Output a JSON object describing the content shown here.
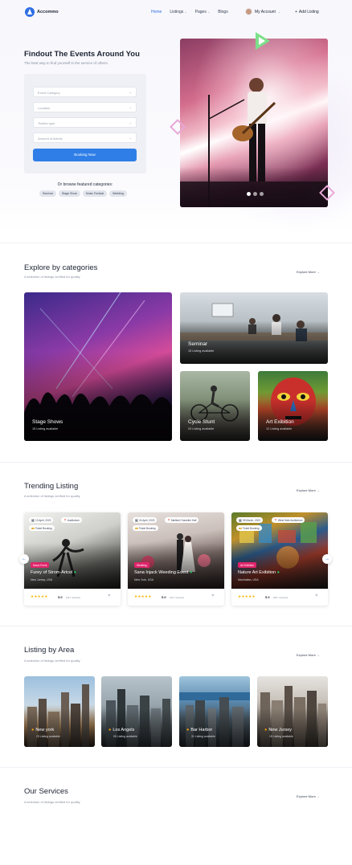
{
  "nav": {
    "logo_text": "Accommo",
    "menu": [
      {
        "label": "Home",
        "active": true
      },
      {
        "label": "Listings",
        "caret": "⌄"
      },
      {
        "label": "Pages",
        "caret": "⌄"
      },
      {
        "label": "Blogs"
      }
    ],
    "account_label": "My Account",
    "account_caret": "⌄",
    "add_listing": "Add Listing",
    "add_icon": "+"
  },
  "hero": {
    "title": "Findout The Events Around You",
    "subtitle": "The best way to find yourself in the service of others.",
    "fields": [
      {
        "placeholder": "Event Category"
      },
      {
        "placeholder": "Location"
      },
      {
        "placeholder": "Tickets type"
      },
      {
        "placeholder": "Amount of tickets"
      }
    ],
    "dropdown_icon": "⌄",
    "book_button": "Booking Now",
    "browse_label": "Or browse featured categories:",
    "tags": [
      "Seminar",
      "Stage Show",
      "Music Festival",
      "Wedding"
    ]
  },
  "categories": {
    "title": "Explore by categories",
    "subtitle": "A selection of listings verified for quality",
    "explore_more": "Explore More →",
    "items": [
      {
        "name": "Stage Shows",
        "count": "15 Listing available"
      },
      {
        "name": "Seminar",
        "count": "15 Listing available"
      },
      {
        "name": "Cycle Stunt",
        "count": "03 Listing available"
      },
      {
        "name": "Art Exibition",
        "count": "12 Listing available"
      }
    ]
  },
  "trending": {
    "title": "Trending Listing",
    "subtitle": "A selection of listings verified for quality",
    "explore_more": "Explore More →",
    "prev_icon": "←",
    "next_icon": "→",
    "cards": [
      {
        "date": "13 April, 2023",
        "venue": "Auditorium",
        "ticket": "Ticket Booking",
        "badge": "Music Event",
        "name": "Furey of Strom-Artcel",
        "location": "New Jursey, USA",
        "stars": "★★★★★",
        "rating": "5.0",
        "reviews": "(187 reviews)",
        "heart": "♥"
      },
      {
        "date": "24 April, 2023",
        "venue": "Mallbuil Chavelier Hall",
        "ticket": "Ticket Booking",
        "badge": "Wedding",
        "name": "Sana Injack Weeding Event",
        "location": "New York, USA",
        "stars": "★★★★★",
        "rating": "5.0",
        "reviews": "(107 reviews)",
        "heart": "♥"
      },
      {
        "date": "08 March, 2022",
        "venue": "West Hale Auditorium",
        "ticket": "Ticket Booking",
        "badge": "Art Exibition",
        "name": "Nature Art Exibition",
        "location": "Manhattan, USA",
        "stars": "★★★★★",
        "rating": "5.0",
        "reviews": "(837 reviews)",
        "heart": "♥"
      }
    ]
  },
  "areas": {
    "title": "Listing by Area",
    "subtitle": "A selection of listings verified for quality",
    "explore_more": "Explore More →",
    "items": [
      {
        "name": "New york",
        "count": "23 Listing available"
      },
      {
        "name": "Los Angels",
        "count": "05 Listing available"
      },
      {
        "name": "Bar Harbor",
        "count": "31 Listing available"
      },
      {
        "name": "New Jursey",
        "count": "15 Listing available"
      }
    ]
  },
  "services": {
    "title": "Our Services",
    "subtitle": "A selection of listings verified for quality",
    "explore_more": "Explore More →"
  },
  "colors": {
    "accent": "#2f6ee4",
    "badge": "#e0246b",
    "star": "#f5b400",
    "pin": "#f59e0b"
  }
}
